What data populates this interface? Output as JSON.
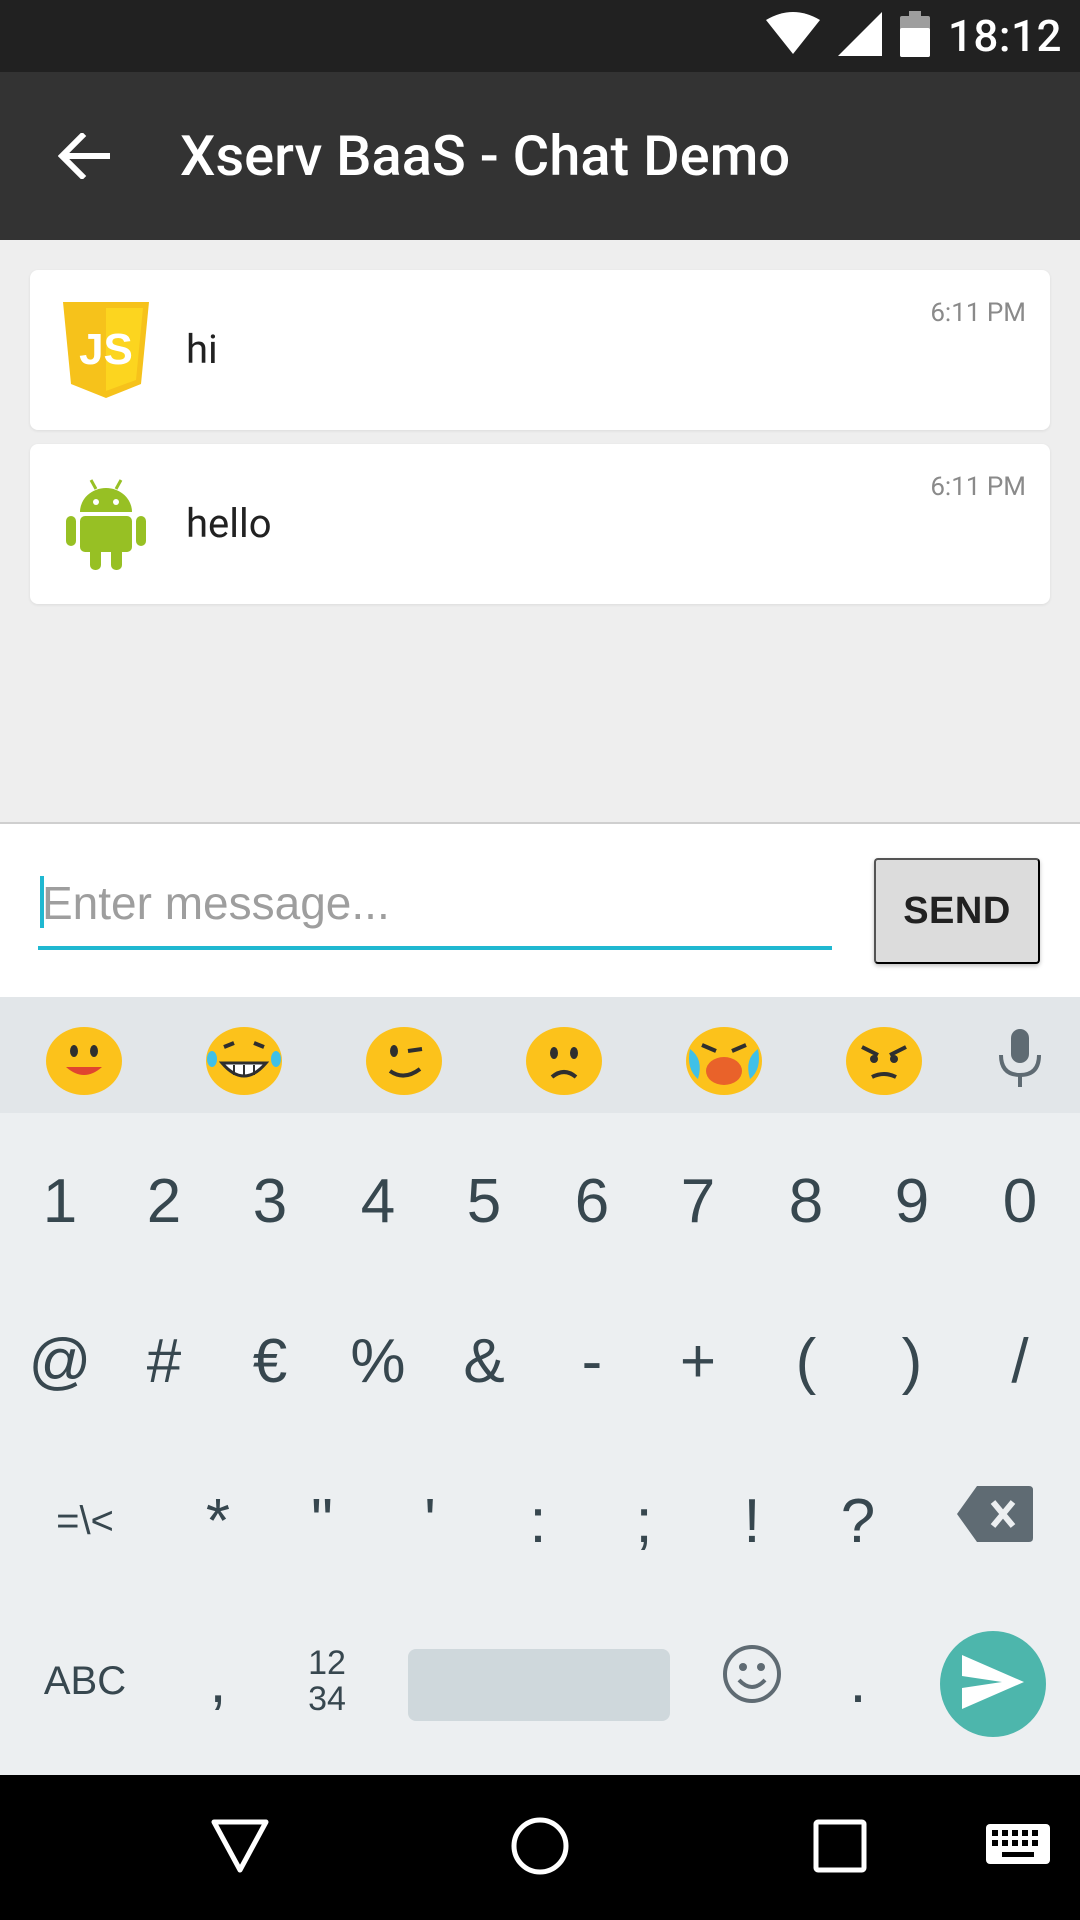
{
  "status_bar": {
    "time": "18:12"
  },
  "app_bar": {
    "title": "Xserv BaaS - Chat Demo"
  },
  "messages": [
    {
      "text": "hi",
      "time": "6:11 PM",
      "avatar": "javascript-logo-icon"
    },
    {
      "text": "hello",
      "time": "6:11 PM",
      "avatar": "android-robot-icon"
    }
  ],
  "composer": {
    "placeholder": "Enter message...",
    "value": "",
    "send_label": "SEND"
  },
  "keyboard": {
    "emoji_row": [
      "smile-emoji",
      "laughing-tears-emoji",
      "wink-emoji",
      "sad-emoji",
      "crying-emoji",
      "angry-emoji",
      "microphone-icon"
    ],
    "row1": [
      "1",
      "2",
      "3",
      "4",
      "5",
      "6",
      "7",
      "8",
      "9",
      "0"
    ],
    "row2": [
      "@",
      "#",
      "€",
      "%",
      "&",
      "-",
      "+",
      "(",
      ")",
      "/"
    ],
    "row3": [
      "=\\<",
      "*",
      "\"",
      "'",
      ":",
      ";",
      "!",
      "?"
    ],
    "row4": {
      "abc": "ABC",
      "comma": ",",
      "numpad_top": "12",
      "numpad_bottom": "34",
      "period": "."
    }
  },
  "colors": {
    "accent": "#1fb8d1",
    "app_bar": "#333333",
    "enter_key": "#4db6ac"
  }
}
